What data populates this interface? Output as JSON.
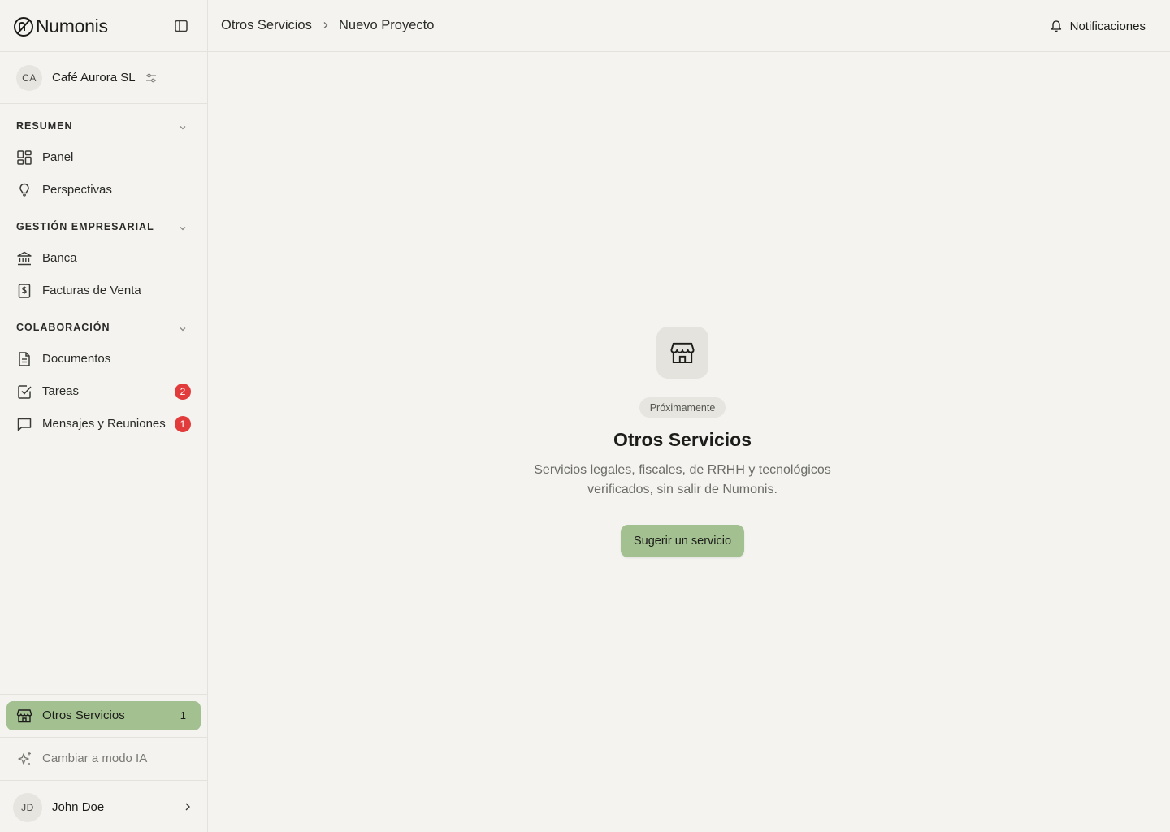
{
  "app": {
    "name": "Numonis"
  },
  "company": {
    "initials": "CA",
    "name": "Café Aurora SL"
  },
  "sidebar": {
    "sections": [
      {
        "title": "RESUMEN",
        "items": [
          {
            "label": "Panel",
            "icon": "dashboard-icon"
          },
          {
            "label": "Perspectivas",
            "icon": "lightbulb-icon"
          }
        ]
      },
      {
        "title": "GESTIÓN EMPRESARIAL",
        "items": [
          {
            "label": "Banca",
            "icon": "bank-icon"
          },
          {
            "label": "Facturas de Venta",
            "icon": "invoice-icon"
          }
        ]
      },
      {
        "title": "COLABORACIÓN",
        "items": [
          {
            "label": "Documentos",
            "icon": "document-icon"
          },
          {
            "label": "Tareas",
            "icon": "checkbox-icon",
            "badge": "2"
          },
          {
            "label": "Mensajes y Reuniones",
            "icon": "message-icon",
            "badge": "1"
          }
        ]
      }
    ],
    "other_services": {
      "label": "Otros Servicios",
      "count": "1",
      "icon": "store-icon"
    },
    "ai_mode": {
      "label": "Cambiar a modo IA",
      "icon": "sparkles-icon"
    },
    "user": {
      "initials": "JD",
      "name": "John Doe"
    }
  },
  "header": {
    "breadcrumb": [
      "Otros Servicios",
      "Nuevo Proyecto"
    ],
    "notifications_label": "Notificaciones"
  },
  "main": {
    "icon": "store-icon",
    "badge": "Próximamente",
    "title": "Otros Servicios",
    "description": "Servicios legales, fiscales, de RRHH y tecnológicos verificados, sin salir de Numonis.",
    "button_label": "Sugerir un servicio"
  },
  "colors": {
    "accent": "#a3c090",
    "background": "#f4f3ef",
    "badge_red": "#e23b3b"
  }
}
